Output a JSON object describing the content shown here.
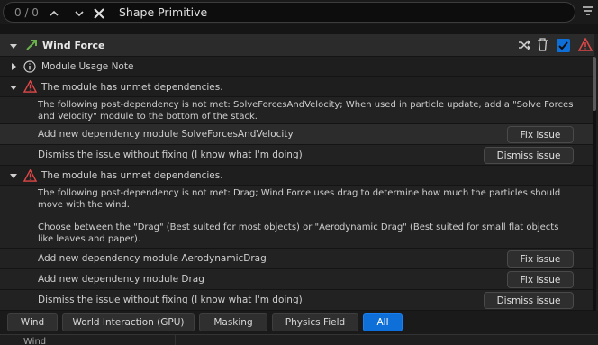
{
  "search": {
    "count": "0 / 0",
    "text": "Shape Primitive"
  },
  "header": {
    "title": "Wind Force"
  },
  "items": {
    "usage_note": "Module Usage Note",
    "warning1_title": "The module has unmet dependencies.",
    "warning1_desc_line1": "The following post-dependency is not met: SolveForcesAndVelocity; When used in particle update, add a \"Solve Forces",
    "warning1_desc_line2": "and Velocity\" module to the bottom of the stack.",
    "add_solve": "Add new dependency module SolveForcesAndVelocity",
    "dismiss1": "Dismiss the issue without fixing (I know what I'm doing)",
    "warning2_title": "The module has unmet dependencies.",
    "warning2_desc_line1": "The following post-dependency is not met: Drag; Wind Force uses drag to determine how much the particles should",
    "warning2_desc_line2": "move with the wind.",
    "warning2_desc_line3": "Choose between the \"Drag\" (Best suited for most objects) or \"Aerodynamic Drag\" (Best suited for small flat objects",
    "warning2_desc_line4": "like leaves and paper).",
    "add_aero": "Add new dependency module AerodynamicDrag",
    "add_drag": "Add new dependency module Drag",
    "dismiss2": "Dismiss the issue without fixing (I know what I'm doing)"
  },
  "buttons": {
    "fix_issue": "Fix issue",
    "dismiss_issue": "Dismiss issue"
  },
  "tabs": [
    {
      "label": "Wind"
    },
    {
      "label": "World Interaction (GPU)"
    },
    {
      "label": "Masking"
    },
    {
      "label": "Physics Field"
    },
    {
      "label": "All"
    }
  ],
  "bottom": {
    "label": "Wind"
  },
  "colors": {
    "warning": "#e04848",
    "accent": "#0f6fd8",
    "module_green": "#4a7a3a"
  }
}
